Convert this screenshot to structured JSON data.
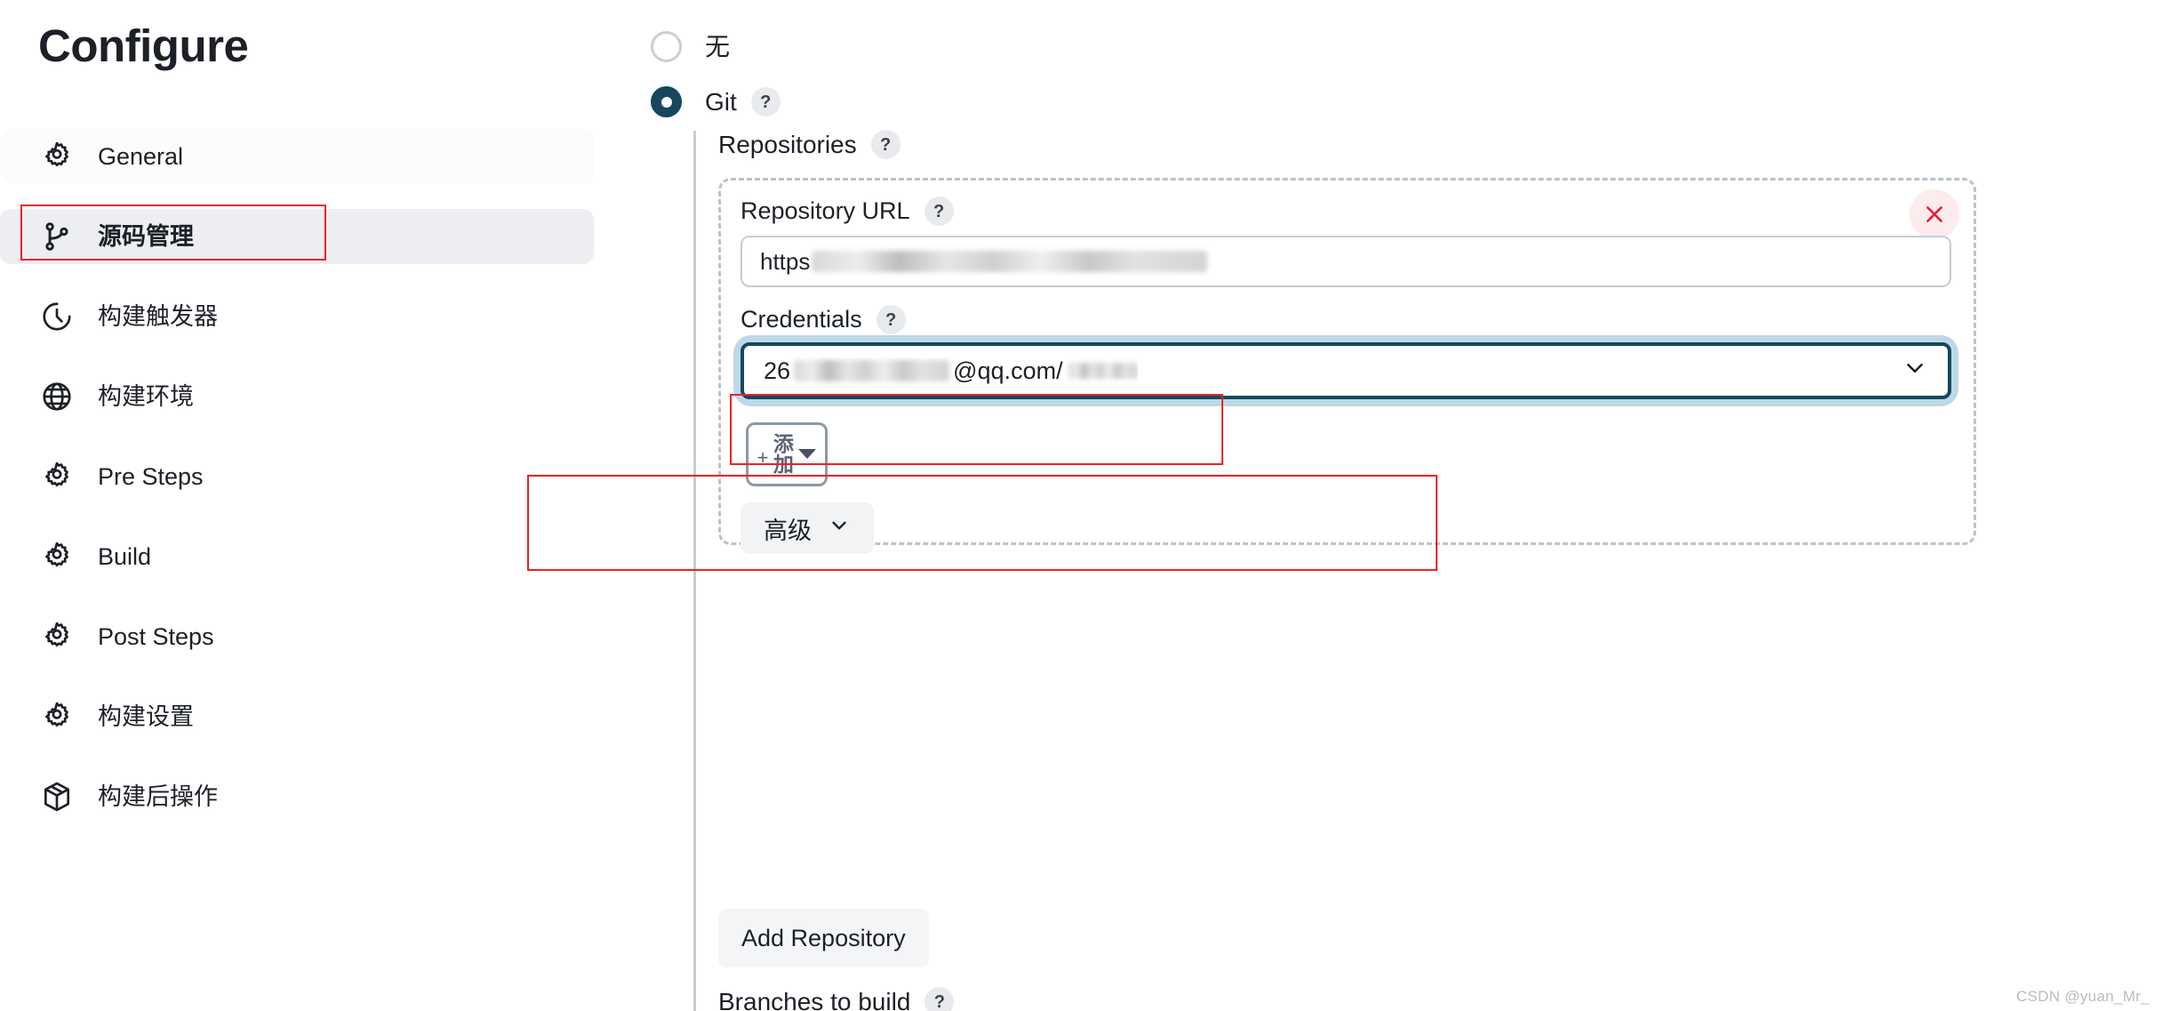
{
  "page": {
    "title": "Configure"
  },
  "sidebar": {
    "items": [
      {
        "label": "General",
        "icon": "gear-icon",
        "state": "hover"
      },
      {
        "label": "源码管理",
        "icon": "branch-icon",
        "state": "active"
      },
      {
        "label": "构建触发器",
        "icon": "clock-icon",
        "state": "normal"
      },
      {
        "label": "构建环境",
        "icon": "globe-icon",
        "state": "normal"
      },
      {
        "label": "Pre Steps",
        "icon": "gear-icon",
        "state": "normal"
      },
      {
        "label": "Build",
        "icon": "gear-icon",
        "state": "normal"
      },
      {
        "label": "Post Steps",
        "icon": "gear-icon",
        "state": "normal"
      },
      {
        "label": "构建设置",
        "icon": "gear-icon",
        "state": "normal"
      },
      {
        "label": "构建后操作",
        "icon": "package-icon",
        "state": "normal"
      }
    ]
  },
  "scm": {
    "options": [
      {
        "label": "无",
        "selected": false
      },
      {
        "label": "Git",
        "selected": true,
        "help": "?"
      }
    ],
    "repositories_label": "Repositories",
    "repositories_help": "?",
    "repository": {
      "url_label": "Repository URL",
      "url_help": "?",
      "url_value": "https",
      "url_redacted": true,
      "credentials_label": "Credentials",
      "credentials_help": "?",
      "credentials_value": "26",
      "credentials_value_tail": "@qq.com/",
      "credentials_redacted": true,
      "add_button_label": "添加",
      "add_button_plus": "+",
      "advanced_label": "高级",
      "delete_icon": "close-icon"
    },
    "add_repository_label": "Add Repository",
    "branches_label": "Branches to build",
    "branches_help": "?"
  },
  "watermark": "CSDN @yuan_Mr_",
  "colors": {
    "accent": "#16475f",
    "focus_ring": "#bdd8e8",
    "annotation": "#ee2222",
    "delete_bg": "#fdeced",
    "sidebar_active": "#edeef2"
  }
}
